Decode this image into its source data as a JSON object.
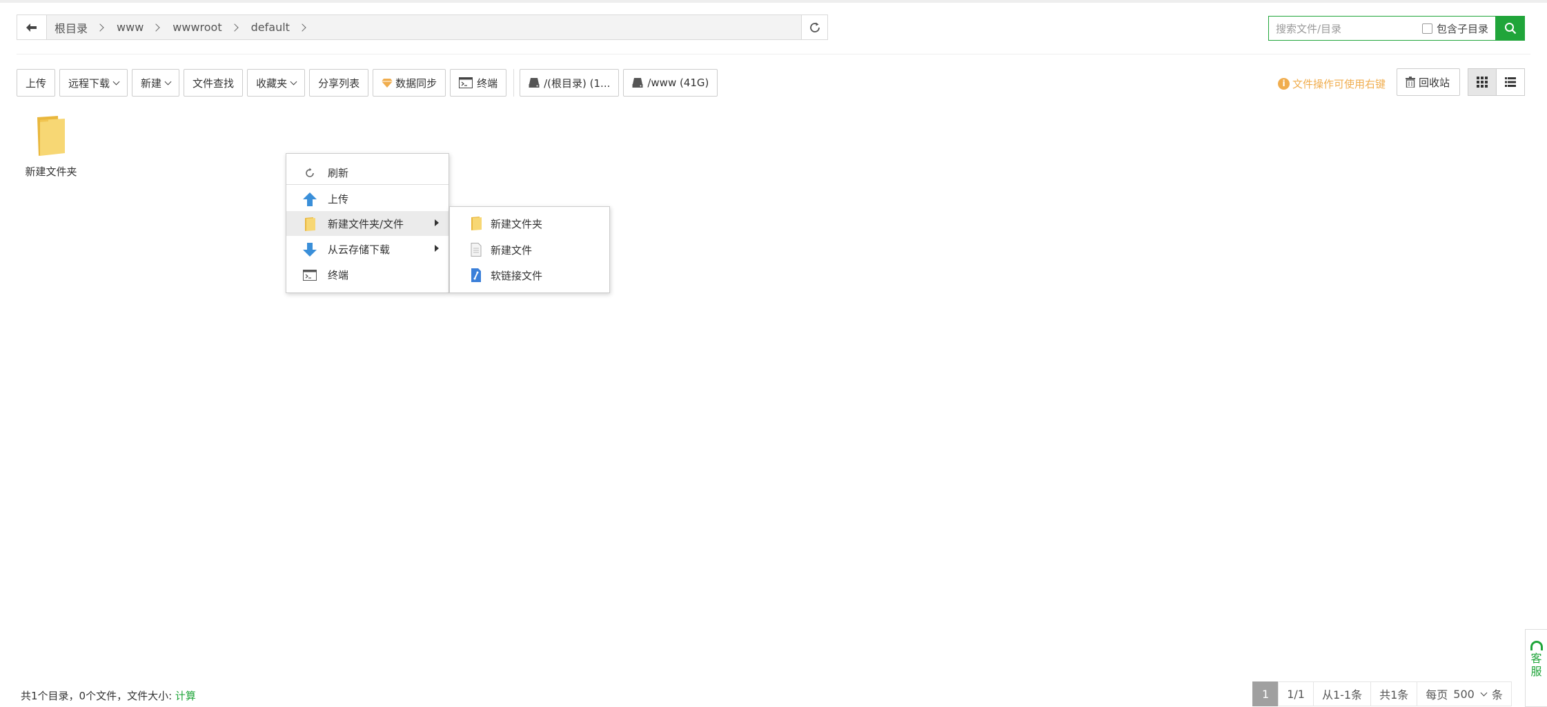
{
  "breadcrumb": {
    "items": [
      "根目录",
      "www",
      "wwwroot",
      "default"
    ]
  },
  "search": {
    "placeholder": "搜索文件/目录",
    "include_subdir_label": "包含子目录"
  },
  "toolbar": {
    "upload": "上传",
    "remote_download": "远程下载",
    "new": "新建",
    "file_search": "文件查找",
    "favorites": "收藏夹",
    "share_list": "分享列表",
    "data_sync": "数据同步",
    "terminal": "终端",
    "disk_root": "/(根目录) (1...",
    "disk_www": "/www (41G)"
  },
  "tip": "文件操作可使用右键",
  "recycle_bin": "回收站",
  "files": [
    {
      "name": "新建文件夹",
      "type": "folder"
    }
  ],
  "context_menu": {
    "items": [
      {
        "label": "刷新",
        "icon": "refresh-icon"
      },
      {
        "label": "上传",
        "icon": "upload-arrow-icon"
      },
      {
        "label": "新建文件夹/文件",
        "icon": "folder-icon",
        "has_submenu": true,
        "highlighted": true
      },
      {
        "label": "从云存储下载",
        "icon": "download-arrow-icon",
        "has_submenu": true
      },
      {
        "label": "终端",
        "icon": "terminal-icon"
      }
    ],
    "submenu": [
      {
        "label": "新建文件夹",
        "icon": "folder-icon"
      },
      {
        "label": "新建文件",
        "icon": "file-icon"
      },
      {
        "label": "软链接文件",
        "icon": "link-file-icon"
      }
    ]
  },
  "footer": {
    "stats": "共1个目录，0个文件，文件大小: ",
    "calc_link": "计算",
    "pagination": {
      "current_page": "1",
      "page_info": "1/1",
      "range": "从1-1条",
      "total": "共1条",
      "per_page_label": "每页",
      "per_page_value": "500",
      "unit": "条"
    }
  },
  "service": {
    "line1": "客",
    "line2": "服"
  },
  "colors": {
    "accent": "#20a53a",
    "tip": "#f0ad4e",
    "folder": "#f7d774"
  }
}
